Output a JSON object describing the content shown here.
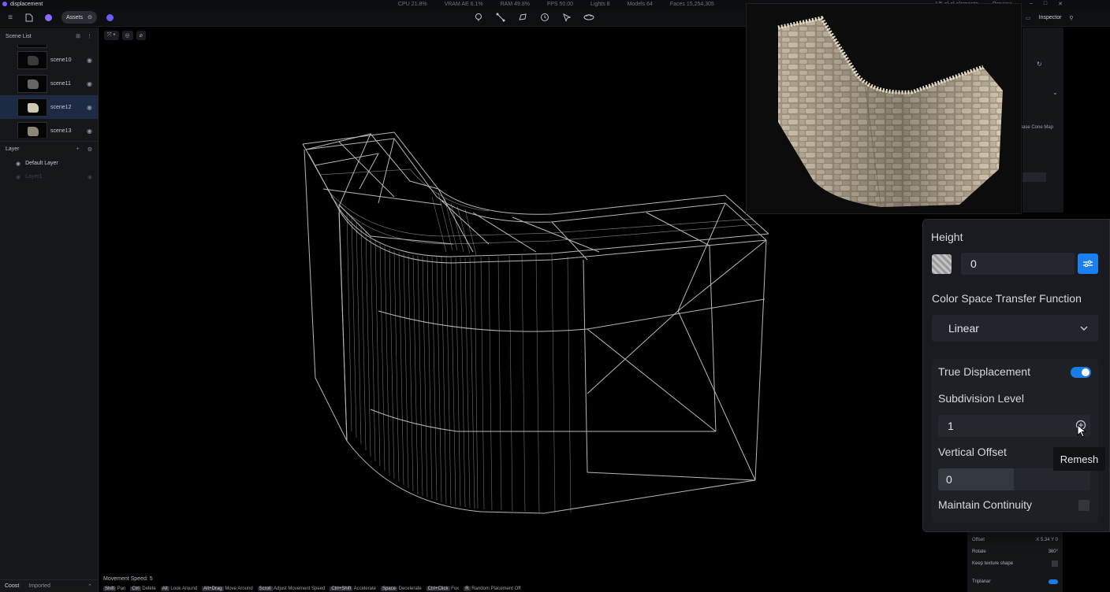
{
  "titlebar": {
    "app_name": "displacement",
    "stats": [
      "CPU 21.8%",
      "VRAM AE 6.1%",
      "RAM 49.8%",
      "FPS 50.00",
      "Lights 8",
      "Models 64",
      "Faces 15,254,305"
    ],
    "right_text": "1/5 el el elements",
    "right_menu": "Preview"
  },
  "toolbar": {
    "assets_label": "Assets"
  },
  "sidebar": {
    "scene_list_title": "Scene List",
    "scenes": [
      {
        "name": "scene10",
        "selected": false
      },
      {
        "name": "scene11",
        "selected": false
      },
      {
        "name": "scene12",
        "selected": true
      },
      {
        "name": "scene13",
        "selected": false
      }
    ],
    "layer_title": "Layer",
    "layers": [
      {
        "name": "Default Layer"
      },
      {
        "name": "Layer1"
      }
    ],
    "footer_tabs": [
      "Coost",
      "Imported"
    ]
  },
  "viewport": {
    "movement_speed": "Movement Speed: 5",
    "hints": [
      {
        "key": "Shift",
        "label": "Pan"
      },
      {
        "key": "Ctrl",
        "label": "Delete"
      },
      {
        "key": "Alt",
        "label": "Look Around"
      },
      {
        "key": "Alt+Drag",
        "label": "Move Around"
      },
      {
        "key": "Scroll",
        "label": "Adjust Movement Speed"
      },
      {
        "key": "Ctrl+Shift",
        "label": "Accelerate"
      },
      {
        "key": "Space",
        "label": "Decelerate"
      },
      {
        "key": "Ctrl+Click",
        "label": "Fox"
      },
      {
        "key": "R",
        "label": "Random Placement Off"
      }
    ]
  },
  "inspector": {
    "title": "Inspector",
    "cone_map": "Base Cone Map",
    "lower": [
      {
        "label": "Offset",
        "value": "X 5.34   Y 0"
      },
      {
        "label": "Rotate",
        "value": "360°"
      },
      {
        "label": "Keep texture shape",
        "value": ""
      },
      {
        "label": "Triplanar",
        "value": ""
      }
    ]
  },
  "panel": {
    "height_label": "Height",
    "height_value": "0",
    "color_space_label": "Color Space Transfer Function",
    "color_space_value": "Linear",
    "true_displacement_label": "True Displacement",
    "true_displacement_on": true,
    "subdivision_label": "Subdivision Level",
    "subdivision_value": "1",
    "vertical_offset_label": "Vertical Offset",
    "vertical_offset_value": "0",
    "maintain_continuity_label": "Maintain Continuity",
    "maintain_continuity_on": false
  },
  "tooltip": {
    "text": "Remesh"
  },
  "colors": {
    "accent": "#1a7ff0",
    "selected_row": "#1c2a44",
    "panel_bg": "#191b20"
  }
}
